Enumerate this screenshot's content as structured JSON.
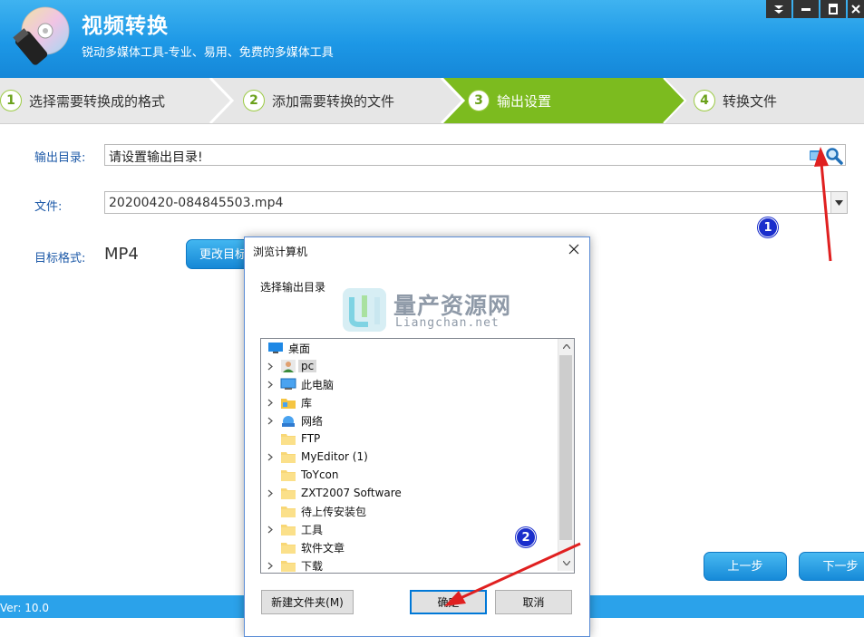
{
  "header": {
    "title": "视频转换",
    "subtitle": "锐动多媒体工具-专业、易用、免费的多媒体工具"
  },
  "steps": [
    {
      "num": "1",
      "label": "选择需要转换成的格式"
    },
    {
      "num": "2",
      "label": "添加需要转换的文件"
    },
    {
      "num": "3",
      "label": "输出设置"
    },
    {
      "num": "4",
      "label": "转换文件"
    }
  ],
  "active_step": 3,
  "form": {
    "output_dir_label": "输出目录:",
    "output_dir_value": "请设置输出目录!",
    "file_label": "文件:",
    "file_value": "20200420-084845503.mp4",
    "target_format_label": "目标格式:",
    "target_format_value": "MP4",
    "change_format_button": "更改目标格式"
  },
  "nav": {
    "prev": "上一步",
    "next": "下一步"
  },
  "status": {
    "version": "Ver: 10.0"
  },
  "annotations": {
    "badge1": "1",
    "badge2": "2"
  },
  "dialog": {
    "title": "浏览计算机",
    "prompt": "选择输出目录",
    "watermark_title": "量产资源网",
    "watermark_sub": "Liangchan.net",
    "tree": [
      {
        "label": "桌面",
        "icon": "desktop-icon",
        "expandable": false,
        "level": 0
      },
      {
        "label": "pc",
        "icon": "user-icon",
        "expandable": true,
        "level": 1,
        "selected": true
      },
      {
        "label": "此电脑",
        "icon": "computer-icon",
        "expandable": true,
        "level": 1
      },
      {
        "label": "库",
        "icon": "library-icon",
        "expandable": true,
        "level": 1
      },
      {
        "label": "网络",
        "icon": "network-icon",
        "expandable": true,
        "level": 1
      },
      {
        "label": "FTP",
        "icon": "folder-icon",
        "expandable": false,
        "level": 1
      },
      {
        "label": "MyEditor (1)",
        "icon": "folder-icon",
        "expandable": true,
        "level": 1
      },
      {
        "label": "ToYcon",
        "icon": "folder-icon",
        "expandable": false,
        "level": 1
      },
      {
        "label": "ZXT2007 Software",
        "icon": "folder-icon",
        "expandable": true,
        "level": 1
      },
      {
        "label": "待上传安装包",
        "icon": "folder-icon",
        "expandable": false,
        "level": 1
      },
      {
        "label": "工具",
        "icon": "folder-icon",
        "expandable": true,
        "level": 1
      },
      {
        "label": "软件文章",
        "icon": "folder-icon",
        "expandable": false,
        "level": 1
      },
      {
        "label": "下载",
        "icon": "folder-icon",
        "expandable": true,
        "level": 1
      }
    ],
    "new_folder_button": "新建文件夹(M)",
    "ok_button": "确定",
    "cancel_button": "取消"
  },
  "colors": {
    "header_blue": "#1d98e6",
    "active_step_green": "#7cbb1f",
    "label_blue": "#1e5aa8",
    "annotation_red": "#e02020",
    "badge_blue": "#1a2ecc"
  }
}
